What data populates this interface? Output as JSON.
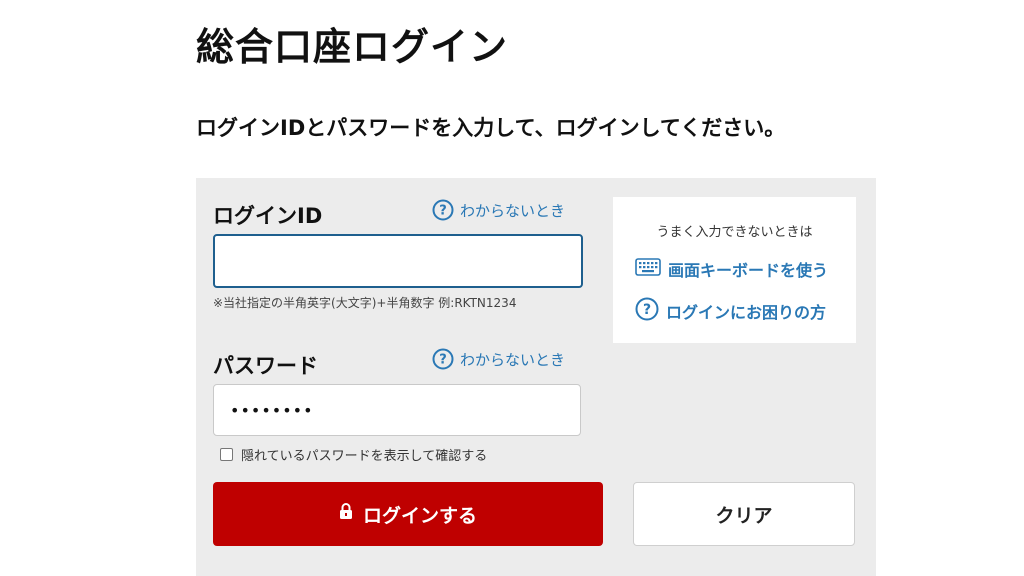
{
  "page": {
    "title": "総合口座ログイン",
    "instruction": "ログインIDとパスワードを入力して、ログインしてください。"
  },
  "login_id": {
    "label": "ログインID",
    "help_text": "わからないとき",
    "value": "",
    "placeholder": "",
    "hint": "※当社指定の半角英字(大文字)+半角数字 例:RKTN1234"
  },
  "password": {
    "label": "パスワード",
    "help_text": "わからないとき",
    "masked_value": "••••••••",
    "show_password_label": "隠れているパスワードを表示して確認する",
    "show_password_checked": false
  },
  "side_box": {
    "caption": "うまく入力できないときは",
    "keyboard_link": "画面キーボードを使う",
    "trouble_link": "ログインにお困りの方"
  },
  "buttons": {
    "login": "ログインする",
    "clear": "クリア"
  },
  "colors": {
    "accent_red": "#bf0000",
    "link_blue": "#2a78b5",
    "panel_gray": "#ececec"
  }
}
